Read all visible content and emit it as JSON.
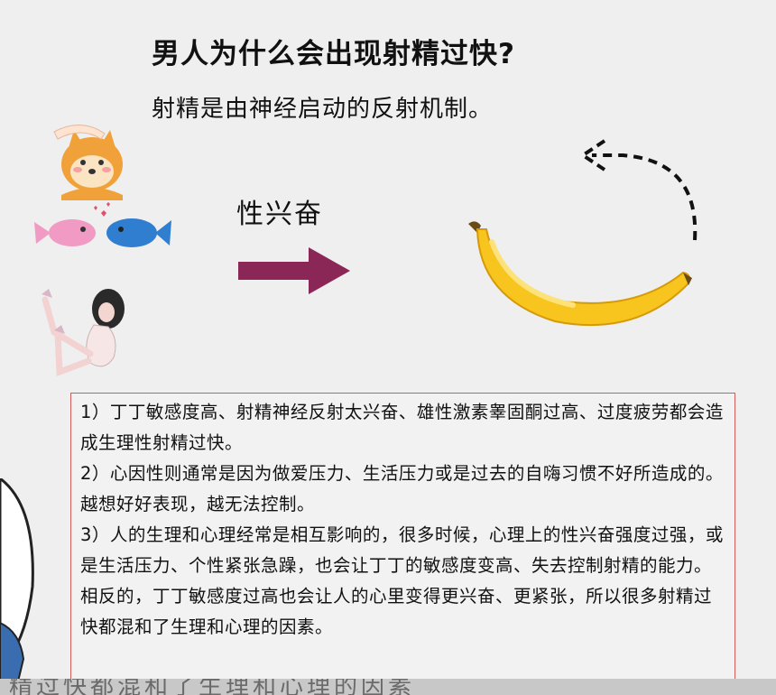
{
  "slide": {
    "title": "男人为什么会出现射精过快?",
    "subtitle": "射精是由神经启动的反射机制。",
    "arrow_label": "性兴奋",
    "points": [
      "1）丁丁敏感度高、射精神经反射太兴奋、雄性激素睾固酮过高、过度疲劳都会造成生理性射精过快。",
      "2）心因性则通常是因为做爱压力、生活压力或是过去的自嗨习惯不好所造成的。越想好好表现，越无法控制。",
      "3）人的生理和心理经常是相互影响的，很多时候，心理上的性兴奋强度过强，或是生活压力、个性紧张急躁，也会让丁丁的敏感度变高、失去控制射精的能力。",
      "相反的，丁丁敏感度过高也会让人的心里变得更兴奋、更紧张，所以很多射精过快都混和了生理和心理的因素。"
    ],
    "subtitle_bar": "精过快都混和了生理和心理的因素"
  },
  "colors": {
    "arrow": "#8a2756",
    "box_border": "#d25b5b",
    "banana": "#f7c51e"
  },
  "icons": {
    "dog": "shiba-dog-icon",
    "fish": "kissing-fish-icon",
    "woman": "woman-illustration",
    "banana": "banana-illustration"
  }
}
